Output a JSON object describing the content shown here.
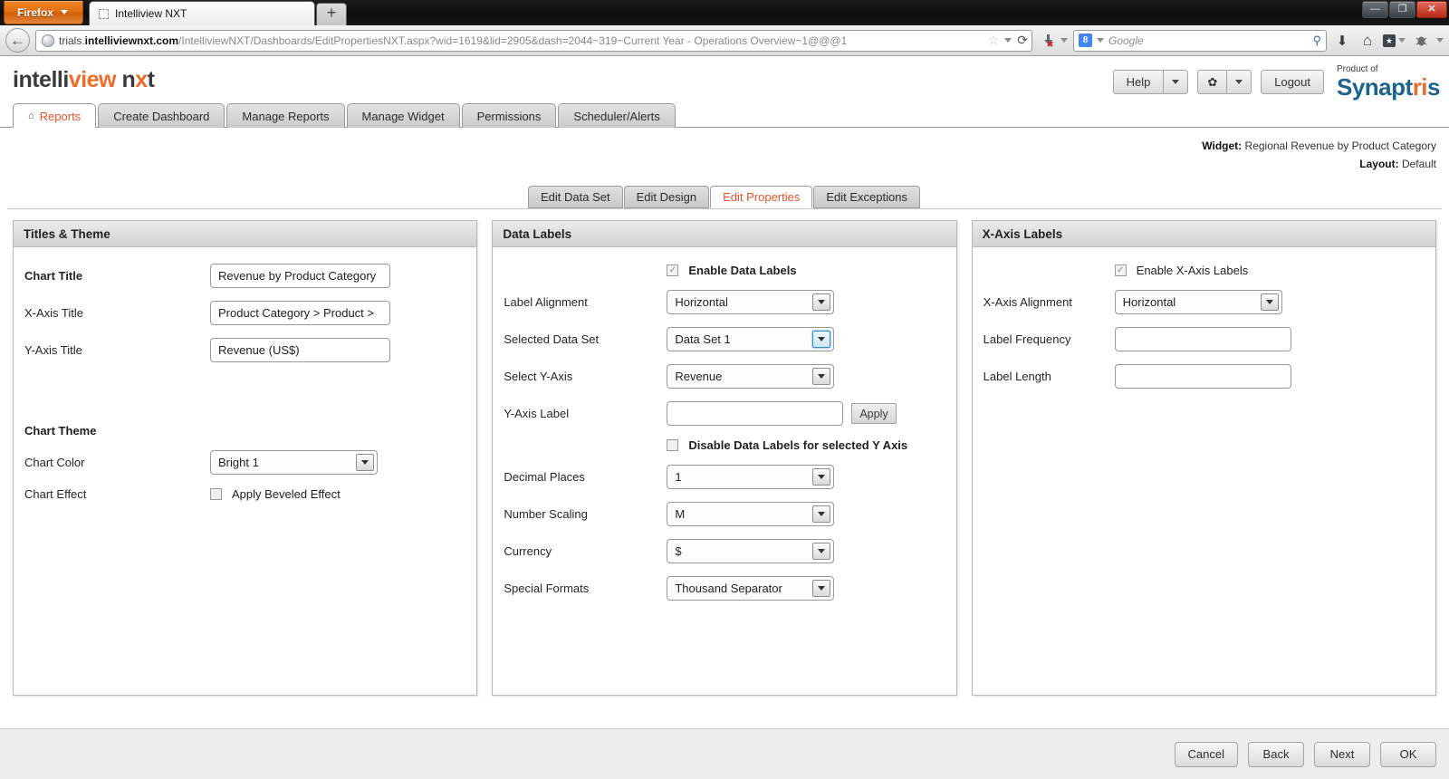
{
  "browser": {
    "app_menu_label": "Firefox",
    "tab_title": "Intelliview NXT",
    "new_tab_label": "+",
    "window_minimize": "—",
    "window_restore": "❐",
    "window_close": "✕",
    "url_prefix": "trials.",
    "url_domain": "intelliviewnxt.com",
    "url_path": "/IntelliviewNXT/Dashboards/EditPropertiesNXT.aspx?wid=1619&lid=2905&dash=2044~319~Current Year - Operations Overview~1@@@1",
    "url_full": "trials.intelliviewnxt.com/IntelliviewNXT/Dashboards/EditPropertiesNXT.aspx?wid=1619&lid=2905&dash=2044~319~Current Year - Operations Overview~1@@@1",
    "search_placeholder": "Google",
    "search_engine_glyph": "8",
    "back_glyph": "←",
    "reload_glyph": "⟳",
    "star_glyph": "☆",
    "magnifier_glyph": "⚲",
    "download_glyph": "⬇",
    "home_glyph": "⌂",
    "bookmark_glyph": "★"
  },
  "header": {
    "logo_part1": "intelli",
    "logo_part2": "view",
    "logo_part3": "n",
    "logo_part4": "x",
    "logo_part5": "t",
    "help_label": "Help",
    "gear_glyph": "✿",
    "logout_label": "Logout",
    "product_of": "Product of",
    "brand_a": "Synapt",
    "brand_i": "ri",
    "brand_b": "s",
    "accent_orange": "#ef6c28",
    "brand_blue": "#1d6390"
  },
  "main_tabs": [
    {
      "label": "Reports",
      "icon": "home-icon",
      "active": true
    },
    {
      "label": "Create Dashboard",
      "active": false
    },
    {
      "label": "Manage Reports",
      "active": false
    },
    {
      "label": "Manage Widget",
      "active": false
    },
    {
      "label": "Permissions",
      "active": false
    },
    {
      "label": "Scheduler/Alerts",
      "active": false
    }
  ],
  "widget_info": {
    "widget_key": "Widget:",
    "widget_value": "Regional Revenue by Product Category",
    "layout_key": "Layout:",
    "layout_value": "Default"
  },
  "sub_tabs": [
    {
      "label": "Edit Data Set",
      "active": false
    },
    {
      "label": "Edit Design",
      "active": false
    },
    {
      "label": "Edit Properties",
      "active": true
    },
    {
      "label": "Edit Exceptions",
      "active": false
    }
  ],
  "panel_titles": {
    "left": "Titles & Theme",
    "middle": "Data Labels",
    "right": "X-Axis Labels"
  },
  "titles_theme": {
    "chart_title_label": "Chart Title",
    "chart_title_value": "Revenue by Product Category",
    "x_axis_title_label": "X-Axis Title",
    "x_axis_title_value": "Product Category > Product >",
    "y_axis_title_label": "Y-Axis Title",
    "y_axis_title_value": "Revenue (US$)",
    "chart_theme_heading": "Chart Theme",
    "chart_color_label": "Chart Color",
    "chart_color_value": "Bright 1",
    "chart_effect_label": "Chart Effect",
    "beveled_effect_label": "Apply Beveled Effect",
    "beveled_effect_checked": false
  },
  "data_labels": {
    "enable_label": "Enable Data Labels",
    "enable_checked": true,
    "label_alignment_label": "Label Alignment",
    "label_alignment_value": "Horizontal",
    "selected_data_set_label": "Selected Data Set",
    "selected_data_set_value": "Data Set 1",
    "select_y_axis_label": "Select Y-Axis",
    "select_y_axis_value": "Revenue",
    "y_axis_label_label": "Y-Axis Label",
    "y_axis_label_value": "",
    "apply_label": "Apply",
    "disable_label": "Disable Data Labels for selected Y Axis",
    "disable_checked": false,
    "decimal_places_label": "Decimal Places",
    "decimal_places_value": "1",
    "number_scaling_label": "Number Scaling",
    "number_scaling_value": "M",
    "currency_label": "Currency",
    "currency_value": "$",
    "special_formats_label": "Special Formats",
    "special_formats_value": "Thousand Separator"
  },
  "x_axis_labels": {
    "enable_label": "Enable X-Axis Labels",
    "enable_checked": true,
    "alignment_label": "X-Axis Alignment",
    "alignment_value": "Horizontal",
    "label_frequency_label": "Label Frequency",
    "label_frequency_value": "",
    "label_length_label": "Label Length",
    "label_length_value": ""
  },
  "footer": {
    "cancel": "Cancel",
    "back": "Back",
    "next": "Next",
    "ok": "OK"
  }
}
